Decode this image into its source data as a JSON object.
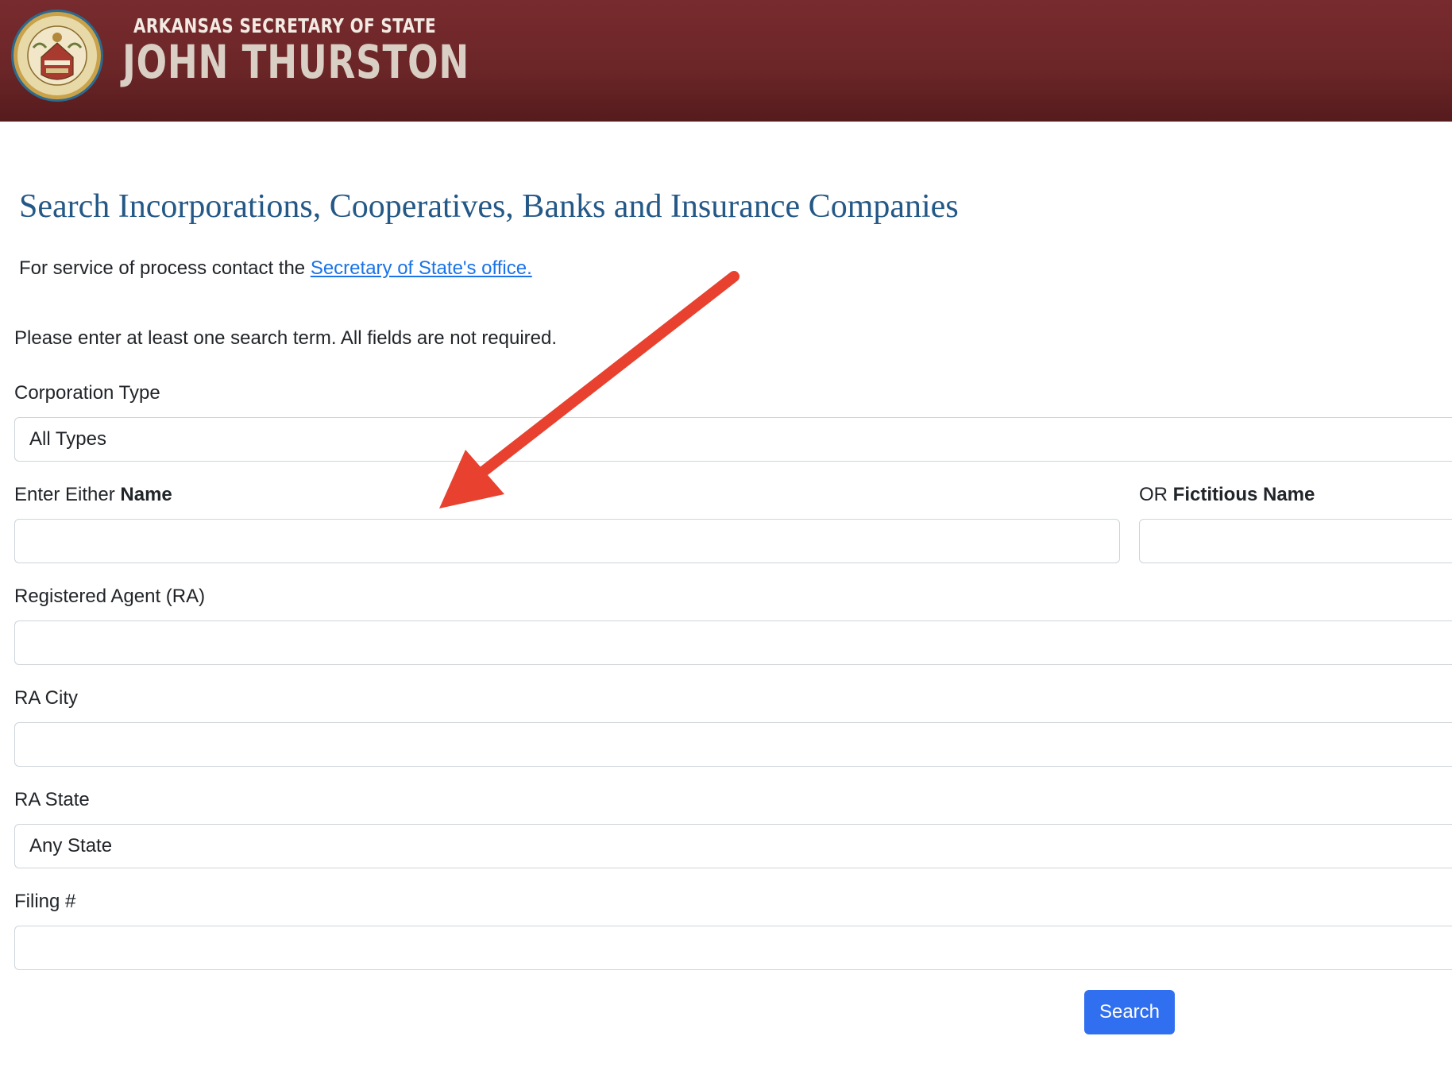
{
  "header": {
    "office": "ARKANSAS SECRETARY OF STATE",
    "name": "JOHN THURSTON",
    "seal_icon": "state-seal-icon"
  },
  "page": {
    "title": "Search Incorporations, Cooperatives, Banks and Insurance Companies",
    "service_prefix": "For service of process contact the ",
    "service_link": "Secretary of State's office.",
    "instructions": "Please enter at least one search term. All fields are not required."
  },
  "form": {
    "corporation_type": {
      "label": "Corporation Type",
      "value": "All Types"
    },
    "name": {
      "label_prefix": "Enter Either ",
      "label_bold": "Name",
      "value": ""
    },
    "fictitious_name": {
      "label_prefix": "OR ",
      "label_bold": "Fictitious Name",
      "value": ""
    },
    "registered_agent": {
      "label": "Registered Agent (RA)",
      "value": ""
    },
    "ra_city": {
      "label": "RA City",
      "value": ""
    },
    "ra_state": {
      "label": "RA State",
      "value": "Any State"
    },
    "filing_number": {
      "label": "Filing #",
      "value": ""
    },
    "search_label": "Search"
  },
  "colors": {
    "banner": "#6c2628",
    "title": "#245886",
    "link": "#1a73e8",
    "button": "#2f6ff0",
    "annotation_arrow": "#e8412f"
  }
}
